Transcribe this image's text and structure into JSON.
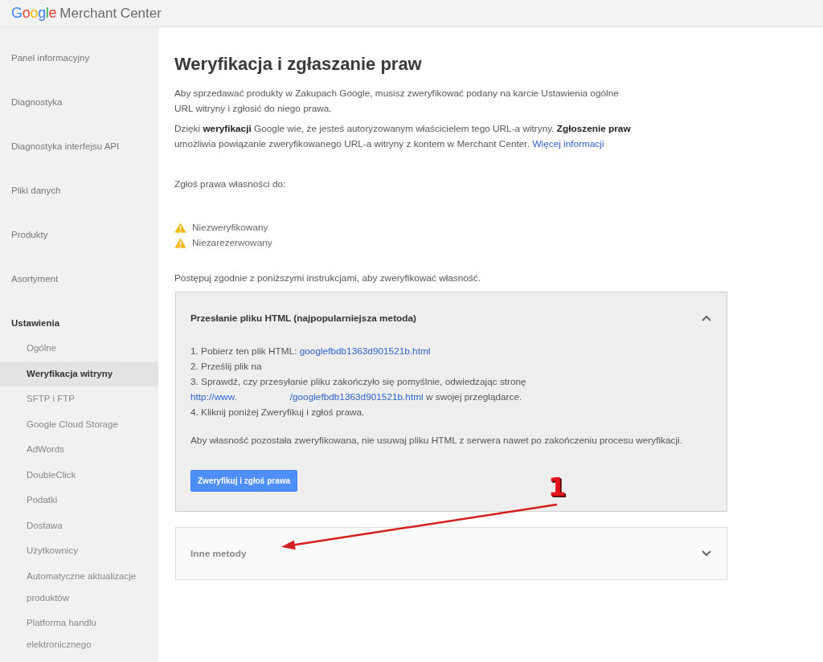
{
  "header": {
    "logo": "Google",
    "product": "Merchant Center"
  },
  "sidebar": {
    "items": [
      {
        "label": "Panel informacyjny",
        "selected": false,
        "expanded": false
      },
      {
        "label": "Diagnostyka",
        "selected": false,
        "expanded": false
      },
      {
        "label": "Diagnostyka interfejsu API",
        "selected": false,
        "expanded": false
      },
      {
        "label": "Pliki danych",
        "selected": false,
        "expanded": false
      },
      {
        "label": "Produkty",
        "selected": false,
        "expanded": false
      },
      {
        "label": "Asortyment",
        "selected": false,
        "expanded": false
      },
      {
        "label": "Ustawienia",
        "selected": false,
        "expanded": true,
        "children": [
          {
            "label": "Ogólne",
            "selected": false
          },
          {
            "label": "Weryfikacja witryny",
            "selected": true
          },
          {
            "label": "SFTP i FTP",
            "selected": false
          },
          {
            "label": "Google Cloud Storage",
            "selected": false
          },
          {
            "label": "AdWords",
            "selected": false
          },
          {
            "label": "DoubleClick",
            "selected": false
          },
          {
            "label": "Podatki",
            "selected": false
          },
          {
            "label": "Dostawa",
            "selected": false
          },
          {
            "label": "Użytkownicy",
            "selected": false
          },
          {
            "label": "Automatyczne aktualizacje produktów",
            "selected": false
          },
          {
            "label": "Platforma handlu elektronicznego",
            "selected": false
          }
        ]
      }
    ]
  },
  "main": {
    "title": "Weryfikacja i zgłaszanie praw",
    "paragraphs": [
      {
        "text": "Aby sprzedawać produkty w Zakupach Google, musisz zweryfikować podany na karcie Ustawienia ogólne\nURL witryny i zgłosić do niego prawa."
      },
      {
        "text": "Dzięki **weryfikacji** Google wie, że jesteś autoryzowanym właścicielem tego URL-a witryny. **Zgłoszenie praw** umożliwia powiązanie zweryfikowanego URL-a witryny z kontem w Merchant Center.",
        "link": "Więcej informacji"
      }
    ],
    "claim_label": "Zgłoś prawa własności do:",
    "statuses": [
      {
        "kind": "warning",
        "label": "Niezweryfikowany"
      },
      {
        "kind": "warning",
        "label": "Niezarezerwowany"
      }
    ],
    "instructions": "Postępuj zgodnie z poniższymi instrukcjami, aby zweryfikować własność.",
    "methods": [
      {
        "title": "Przesłanie pliku HTML (najpopularniejsza metoda)",
        "expanded": true,
        "steps": [
          {
            "parts": [
              {
                "kind": "text",
                "text": "1. Pobierz ten plik HTML: "
              },
              {
                "kind": "link",
                "text": "googlefbdb1363d901521b.html"
              }
            ]
          },
          {
            "parts": [
              {
                "kind": "text",
                "text": "2. Prześlij plik na"
              }
            ]
          },
          {
            "parts": [
              {
                "kind": "text",
                "text": "3. Sprawdź, czy przesyłanie pliku zakończyło się pomyślnie, odwiedzając stronę"
              },
              {
                "kind": "break"
              },
              {
                "kind": "link",
                "text": "http://www."
              },
              {
                "kind": "redacted"
              },
              {
                "kind": "link",
                "text": "/googlefbdb1363d901521b.html"
              },
              {
                "kind": "text",
                "text": " w swojej przeglądarce."
              }
            ]
          },
          {
            "parts": [
              {
                "kind": "text",
                "text": "4. Kliknij poniżej Zweryfikuj i zgłoś prawa."
              }
            ]
          }
        ],
        "note": "Aby własność pozostała zweryfikowana, nie usuwaj pliku HTML z serwera nawet po zakończeniu procesu weryfikacji.",
        "button": "Zweryfikuj i zgłoś prawa"
      },
      {
        "title": "Inne metody",
        "expanded": false
      }
    ],
    "annotation": {
      "label": "1"
    }
  }
}
